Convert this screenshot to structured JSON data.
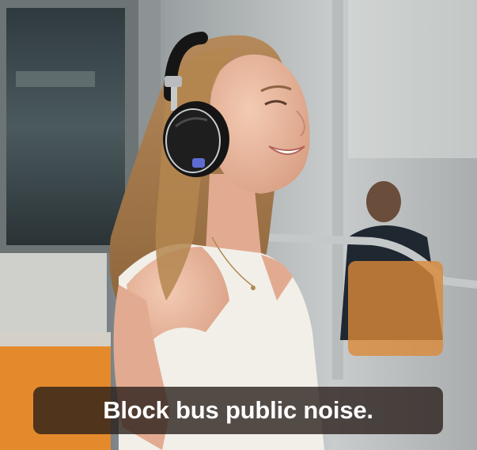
{
  "caption": {
    "text": "Block bus public noise."
  },
  "colors": {
    "seat_orange": "#e58a2c",
    "headphone_black": "#151515",
    "tank_top_white": "#f2efe9",
    "hair_brown": "#a4784a",
    "caption_background": "#261c18"
  }
}
